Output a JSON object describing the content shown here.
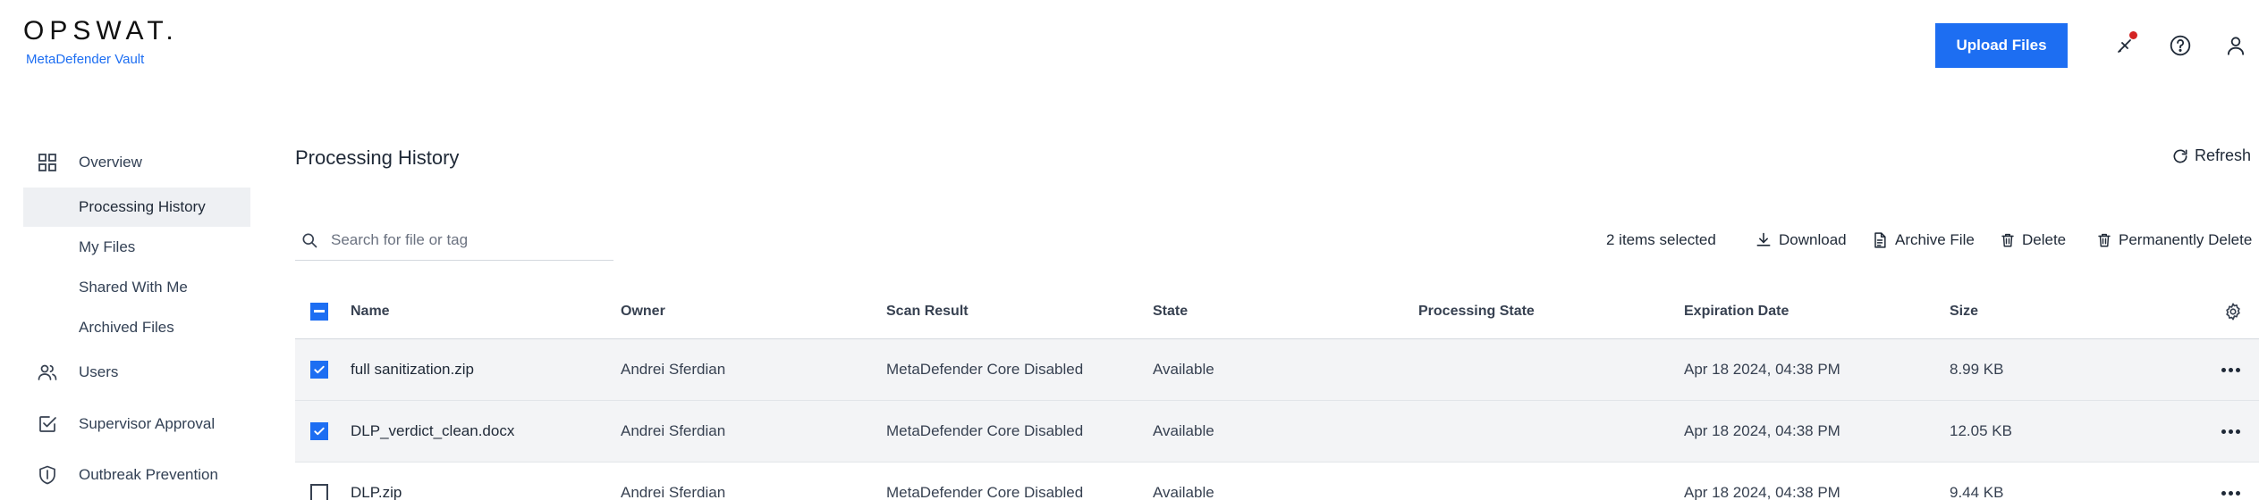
{
  "brand": {
    "logo": "OPSWAT.",
    "product": "MetaDefender Vault"
  },
  "header": {
    "upload_label": "Upload Files",
    "icons": [
      "notification-bell-icon",
      "help-icon",
      "user-icon"
    ],
    "accent": "#1d6ef2",
    "notification_dot_color": "#d42424"
  },
  "sidebar": {
    "items": [
      {
        "label": "Overview",
        "icon": "grid-icon"
      },
      {
        "label": "Processing History",
        "active": true
      },
      {
        "label": "My Files"
      },
      {
        "label": "Shared With Me"
      },
      {
        "label": "Archived Files"
      },
      {
        "label": "Users",
        "icon": "users-icon"
      },
      {
        "label": "Supervisor Approval",
        "icon": "approval-icon"
      },
      {
        "label": "Outbreak Prevention",
        "icon": "shield-icon"
      }
    ]
  },
  "main": {
    "title": "Processing History",
    "refresh_label": "Refresh",
    "search_placeholder": "Search for file or tag",
    "selection_text": "2 items selected",
    "actions": {
      "download": "Download",
      "archive": "Archive File",
      "delete": "Delete",
      "permanent_delete": "Permanently Delete"
    }
  },
  "table": {
    "columns": [
      "Name",
      "Owner",
      "Scan Result",
      "State",
      "Processing State",
      "Expiration Date",
      "Size"
    ],
    "rows": [
      {
        "checked": true,
        "name": "full sanitization.zip",
        "owner": "Andrei Sferdian",
        "scan_result": "MetaDefender Core Disabled",
        "state": "Available",
        "processing_state": "",
        "expiration": "Apr 18 2024, 04:38 PM",
        "size": "8.99 KB"
      },
      {
        "checked": true,
        "name": "DLP_verdict_clean.docx",
        "owner": "Andrei Sferdian",
        "scan_result": "MetaDefender Core Disabled",
        "state": "Available",
        "processing_state": "",
        "expiration": "Apr 18 2024, 04:38 PM",
        "size": "12.05 KB"
      },
      {
        "checked": false,
        "name": "DLP.zip",
        "owner": "Andrei Sferdian",
        "scan_result": "MetaDefender Core Disabled",
        "state": "Available",
        "processing_state": "",
        "expiration": "Apr 18 2024, 04:38 PM",
        "size": "9.44 KB"
      }
    ]
  }
}
